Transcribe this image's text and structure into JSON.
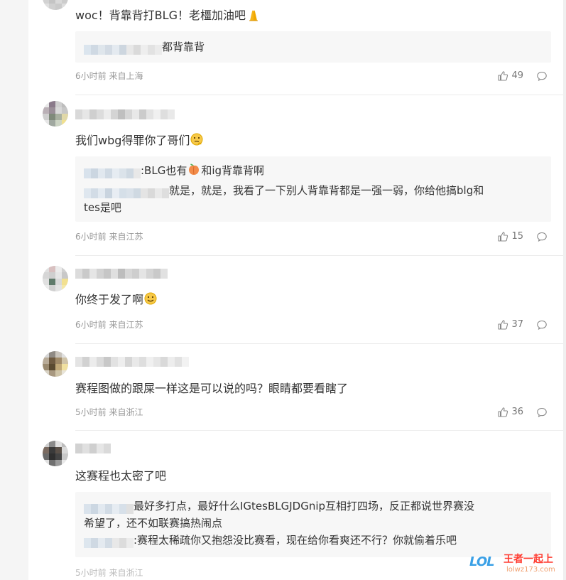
{
  "comments": [
    {
      "text": "woc！背靠背打BLG！老橿加油吧",
      "reply_suffix": "都背靠背",
      "meta": "6小时前 来自上海",
      "likes": "49"
    },
    {
      "text": "我们wbg得罪你了哥们",
      "reply1_suffix": ":BLG也有",
      "reply1_after_peach": "和ig背靠背啊",
      "reply2_line1": "就是，就是，我看了一下别人背靠背都是一强一弱，你给他搞blg和",
      "reply2_line2": "tes是吧",
      "meta": "6小时前 来自江苏",
      "likes": "15"
    },
    {
      "text": "你终于发了啊",
      "meta": "6小时前 来自江苏",
      "likes": "37"
    },
    {
      "text": "赛程图做的跟屎一样这是可以说的吗？眼睛都要看瞎了",
      "meta": "5小时前 来自浙江",
      "likes": "36"
    },
    {
      "text": "这赛程也太密了吧",
      "reply1_line1": "最好多打点，最好什么IGtesBLGJDGnip互相打四场，反正都说世界赛没",
      "reply1_line2": "希望了，还不如联赛搞热闹点",
      "reply2_line1": ":赛程太稀疏你又抱怨没比赛看，现在给你看爽还不行？你就偷着乐吧",
      "meta_partial": "5小时前 来自浙江"
    }
  ],
  "watermark": {
    "logo": "LOL",
    "title": "王者一起上",
    "sub": "lolwz173.com"
  },
  "icons": [
    "thumb-up-icon",
    "reply-bubble-icon",
    "pray-emoji-icon",
    "thinking-emoji-icon",
    "peach-emoji-icon",
    "smile-emoji-icon"
  ]
}
